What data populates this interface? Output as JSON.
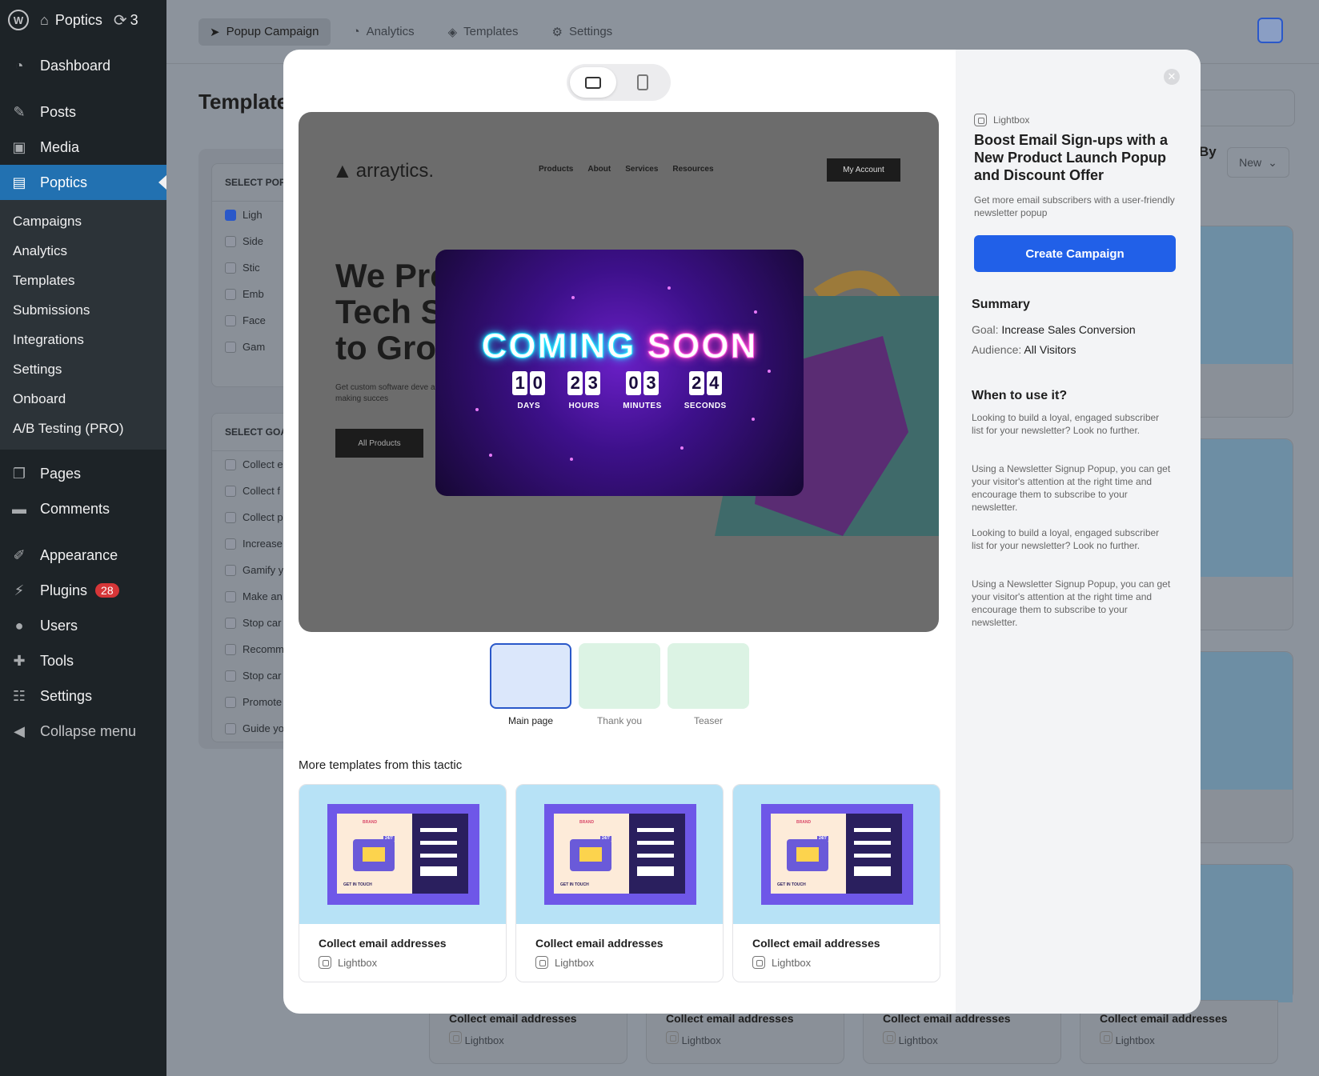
{
  "wp": {
    "site_name": "Poptics",
    "updates": "3",
    "menu": {
      "dashboard": "Dashboard",
      "posts": "Posts",
      "media": "Media",
      "poptics": "Poptics",
      "pages": "Pages",
      "comments": "Comments",
      "appearance": "Appearance",
      "plugins": "Plugins",
      "plugins_badge": "28",
      "users": "Users",
      "tools": "Tools",
      "settings": "Settings",
      "collapse": "Collapse menu"
    },
    "submenu": [
      "Campaigns",
      "Analytics",
      "Templates",
      "Submissions",
      "Integrations",
      "Settings",
      "Onboard",
      "A/B Testing (PRO)"
    ]
  },
  "app": {
    "tabs": [
      "Popup Campaign",
      "Analytics",
      "Templates",
      "Settings"
    ],
    "page_title": "Template",
    "sort_label": "By",
    "sort_value": "New",
    "select_popup_header": "SELECT POP",
    "popup_types": [
      "Ligh",
      "Side",
      "Stic",
      "Emb",
      "Face",
      "Gam"
    ],
    "select_goal_header": "SELECT GOA",
    "goals": [
      "Collect e",
      "Collect f",
      "Collect p",
      "Increase",
      "Gamify y",
      "Make an",
      "Stop car",
      "Recomm",
      "Stop car",
      "Promote",
      "Guide yo"
    ],
    "card_suffix": "esses",
    "bottom_cards": [
      {
        "name": "Collect email addresses",
        "type": "Lightbox"
      },
      {
        "name": "Collect email addresses",
        "type": "Lightbox"
      },
      {
        "name": "Collect email addresses",
        "type": "Lightbox"
      },
      {
        "name": "Collect email addresses",
        "type": "Lightbox"
      }
    ]
  },
  "modal": {
    "preview": {
      "logo": "arraytics.",
      "nav": [
        "Products",
        "About",
        "Services",
        "Resources"
      ],
      "account": "My Account",
      "hero": [
        "We Pro",
        "Tech S",
        "to Grow"
      ],
      "sub": "Get custom software deve a company making succes",
      "button": "All Products",
      "popup": {
        "word1": "COMING",
        "word2": "SOON",
        "countdown": [
          {
            "digits": [
              "1",
              "0"
            ],
            "label": "DAYS"
          },
          {
            "digits": [
              "2",
              "3"
            ],
            "label": "HOURS"
          },
          {
            "digits": [
              "0",
              "3"
            ],
            "label": "MINUTES"
          },
          {
            "digits": [
              "2",
              "4"
            ],
            "label": "SECONDS"
          }
        ]
      }
    },
    "thumbs": [
      "Main page",
      "Thank you",
      "Teaser"
    ],
    "more_title": "More templates from this tactic",
    "more_cards": [
      {
        "name": "Collect email addresses",
        "type": "Lightbox"
      },
      {
        "name": "Collect email addresses",
        "type": "Lightbox"
      },
      {
        "name": "Collect email addresses",
        "type": "Lightbox"
      }
    ],
    "art_labels": {
      "brand": "BRAND",
      "badge": "24/7",
      "cta": "GET IN TOUCH"
    },
    "right": {
      "type": "Lightbox",
      "title": "Boost Email Sign-ups with a New Product Launch Popup and Discount Offer",
      "desc": "Get more email subscribers with a user-friendly newsletter popup",
      "cta": "Create Campaign",
      "summary_title": "Summary",
      "goal_label": "Goal:",
      "goal_value": "Increase Sales Conversion",
      "audience_label": "Audience:",
      "audience_value": "All Visitors",
      "when_title": "When to use it?",
      "paras": [
        "Looking to build a loyal, engaged subscriber list for your newsletter? Look no further.",
        "Using a Newsletter Signup Popup, you can get your visitor's attention at the right time and encourage them to subscribe to your newsletter.",
        "Looking to build a loyal, engaged subscriber list for your newsletter? Look no further.",
        "Using a Newsletter Signup Popup, you can get your visitor's attention at the right time and encourage them to subscribe to your newsletter."
      ]
    }
  }
}
